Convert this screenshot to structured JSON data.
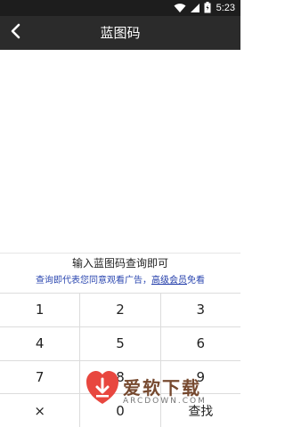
{
  "status_bar": {
    "time": "5:23",
    "icons": [
      "wifi-icon",
      "signal-icon",
      "battery-icon"
    ]
  },
  "app_bar": {
    "title": "蓝图码",
    "back_icon": "chevron-left-icon"
  },
  "hint": {
    "text": "输入蓝图码查询即可"
  },
  "notice": {
    "prefix": "查询即代表您同意观看广告，",
    "vip_link": "高级会员",
    "suffix": "免看"
  },
  "keypad": {
    "rows": [
      [
        "1",
        "2",
        "3"
      ],
      [
        "4",
        "5",
        "6"
      ],
      [
        "7",
        "8",
        "9"
      ],
      [
        "×",
        "0",
        "查找"
      ]
    ]
  },
  "watermark": {
    "text": "爱软下载",
    "subtext": "ARCDOWN.COM"
  },
  "colors": {
    "app_bar": "#2b2b2b",
    "status_bar": "#1d1d1d",
    "link": "#2b47b0"
  }
}
